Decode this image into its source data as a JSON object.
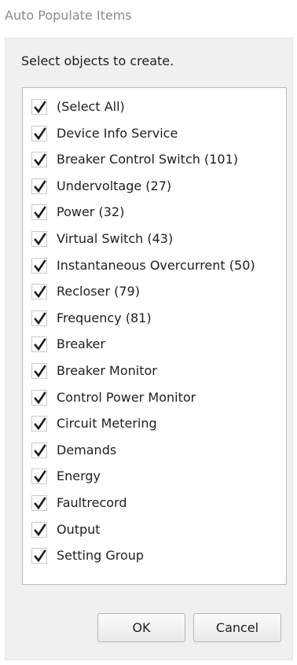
{
  "window": {
    "title": "Auto Populate Items"
  },
  "dialog": {
    "instruction": "Select objects to create.",
    "items": [
      {
        "label": "(Select All)",
        "checked": true
      },
      {
        "label": "Device Info Service",
        "checked": true
      },
      {
        "label": "Breaker Control Switch (101)",
        "checked": true
      },
      {
        "label": "Undervoltage (27)",
        "checked": true
      },
      {
        "label": "Power (32)",
        "checked": true
      },
      {
        "label": "Virtual Switch (43)",
        "checked": true
      },
      {
        "label": "Instantaneous Overcurrent (50)",
        "checked": true
      },
      {
        "label": "Recloser (79)",
        "checked": true
      },
      {
        "label": "Frequency (81)",
        "checked": true
      },
      {
        "label": "Breaker",
        "checked": true
      },
      {
        "label": "Breaker Monitor",
        "checked": true
      },
      {
        "label": "Control Power Monitor",
        "checked": true
      },
      {
        "label": "Circuit Metering",
        "checked": true
      },
      {
        "label": "Demands",
        "checked": true
      },
      {
        "label": "Energy",
        "checked": true
      },
      {
        "label": "Faultrecord",
        "checked": true
      },
      {
        "label": "Output",
        "checked": true
      },
      {
        "label": "Setting Group",
        "checked": true
      }
    ],
    "ok_label": "OK",
    "cancel_label": "Cancel"
  },
  "icons": {
    "check": "checkmark-icon"
  },
  "colors": {
    "panel_background": "#f0f0f0",
    "list_background": "#ffffff",
    "title_text": "#8a8a8a",
    "text": "#1e1e1e"
  }
}
